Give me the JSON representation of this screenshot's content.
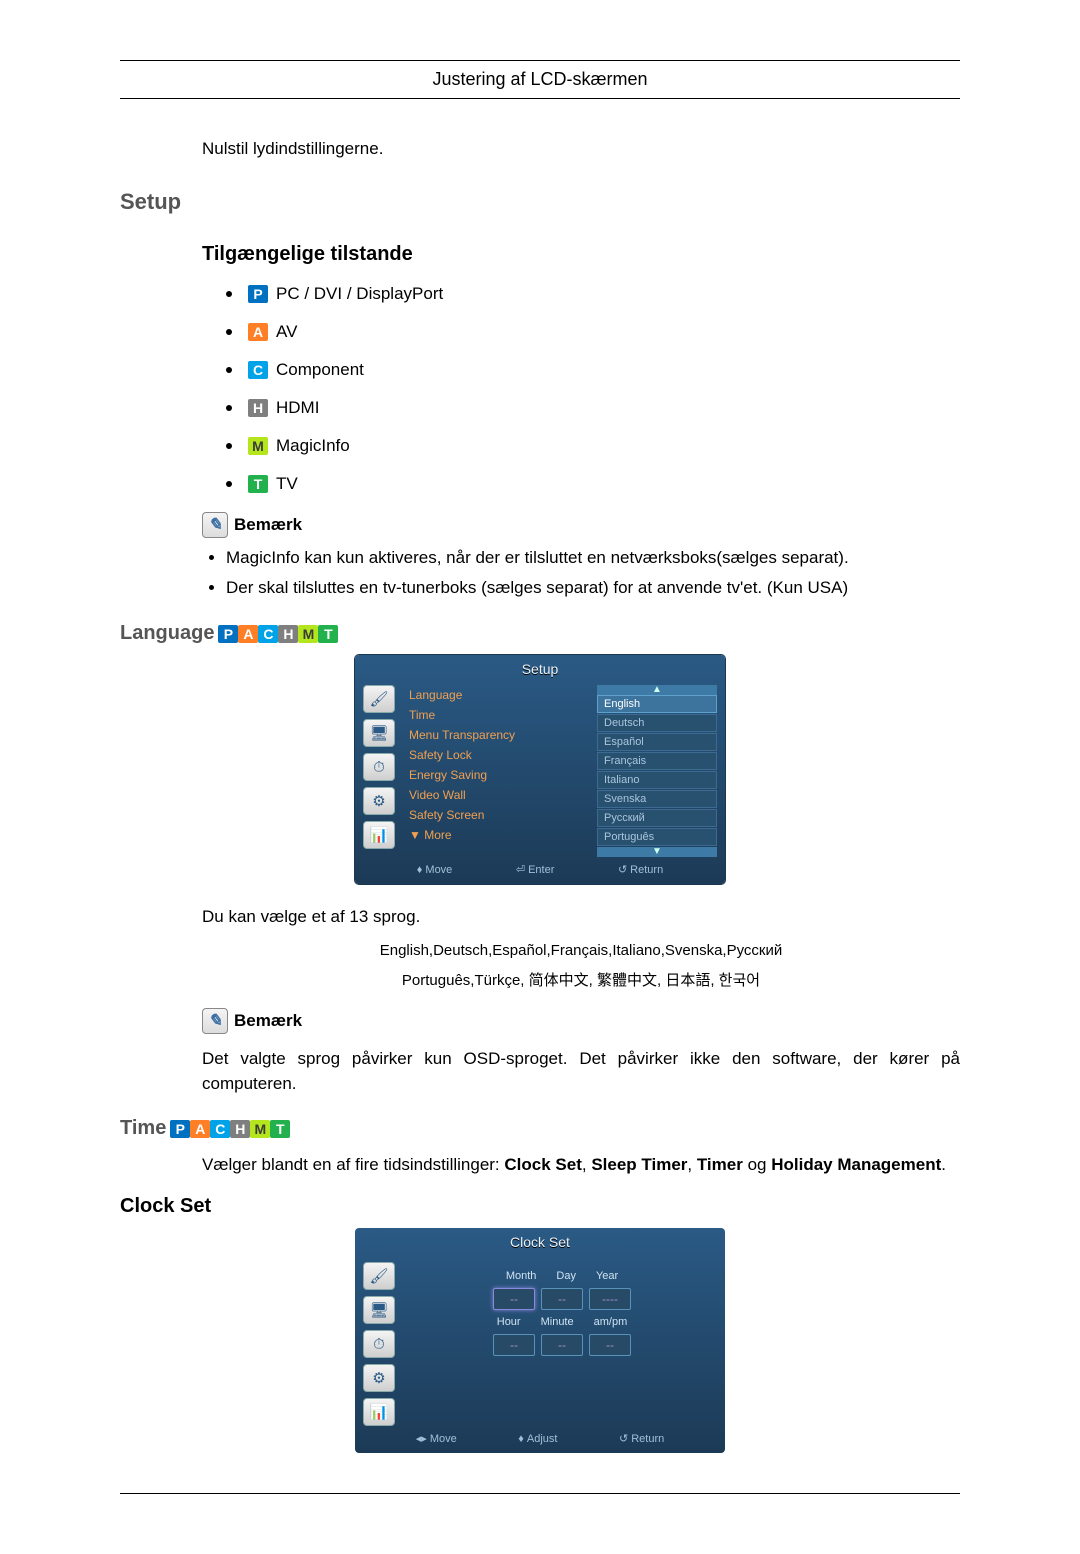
{
  "header": {
    "title": "Justering af LCD-skærmen"
  },
  "reset_text": "Nulstil lydindstillingerne.",
  "setup_heading": "Setup",
  "modes_heading": "Tilgængelige tilstande",
  "modes": [
    {
      "icon": "P",
      "label": "PC / DVI / DisplayPort"
    },
    {
      "icon": "A",
      "label": "AV"
    },
    {
      "icon": "C",
      "label": "Component"
    },
    {
      "icon": "H",
      "label": "HDMI"
    },
    {
      "icon": "M",
      "label": "MagicInfo"
    },
    {
      "icon": "T",
      "label": "TV"
    }
  ],
  "note_label": "Bemærk",
  "notes_setup": [
    "MagicInfo kan kun aktiveres, når der er tilsluttet en netværksboks(sælges separat).",
    "Der skal tilsluttes en tv-tunerboks (sælges separat) for at anvende tv'et. (Kun USA)"
  ],
  "language_heading": "Language",
  "osd_setup": {
    "title": "Setup",
    "menu": [
      "Language",
      "Time",
      "Menu Transparency",
      "Safety Lock",
      "Energy Saving",
      "Video Wall",
      "Safety Screen"
    ],
    "more": "▼ More",
    "options": [
      "English",
      "Deutsch",
      "Español",
      "Français",
      "Italiano",
      "Svenska",
      "Русский",
      "Português"
    ],
    "selected_index": 0,
    "footer": {
      "move": "Move",
      "enter": "Enter",
      "return": "Return"
    }
  },
  "lang_intro": "Du kan vælge et af 13 sprog.",
  "lang_list1": "English,Deutsch,Español,Français,Italiano,Svenska,Русский",
  "lang_list2": "Português,Türkçe, 简体中文, 繁體中文, 日本語, 한국어",
  "lang_note": "Det valgte sprog påvirker kun OSD-sproget. Det påvirker ikke den software, der kører på computeren.",
  "time_heading": "Time",
  "time_intro_a": "Vælger blandt en af fire tidsindstillinger: ",
  "time_intro_b1": "Clock Set",
  "time_intro_b2": "Sleep Timer",
  "time_intro_b3": "Timer",
  "time_intro_b4": "Holiday Management",
  "time_intro_sep": ", ",
  "time_intro_og": " og ",
  "time_intro_end": ".",
  "clockset_heading": "Clock Set",
  "osd_clock": {
    "title": "Clock Set",
    "labels1": [
      "Month",
      "Day",
      "Year"
    ],
    "labels2": [
      "Hour",
      "Minute",
      "am/pm"
    ],
    "footer": {
      "move": "Move",
      "adjust": "Adjust",
      "return": "Return"
    }
  }
}
